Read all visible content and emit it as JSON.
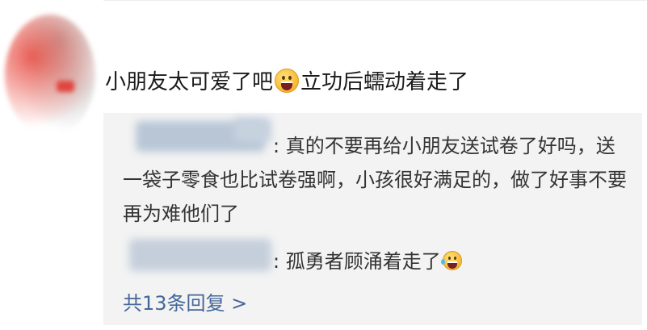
{
  "comment": {
    "text_before": "小朋友太可爱了吧",
    "emoji": "grinning-face-emoji",
    "text_after": "立功后蠕动着走了"
  },
  "replies": [
    {
      "prefix": ":",
      "text": "真的不要再给小朋友送试卷了好吗，送一袋子零食也比试卷强啊，小孩很好满足的，做了好事不要再为难他们了"
    },
    {
      "prefix": ":",
      "text": "孤勇者顾涌着走了",
      "emoji": "laughing-tears-emoji"
    }
  ],
  "more_replies": {
    "label": "共13条回复 >"
  },
  "colors": {
    "link": "#44679a",
    "reply_bg": "#f3f3f3"
  }
}
